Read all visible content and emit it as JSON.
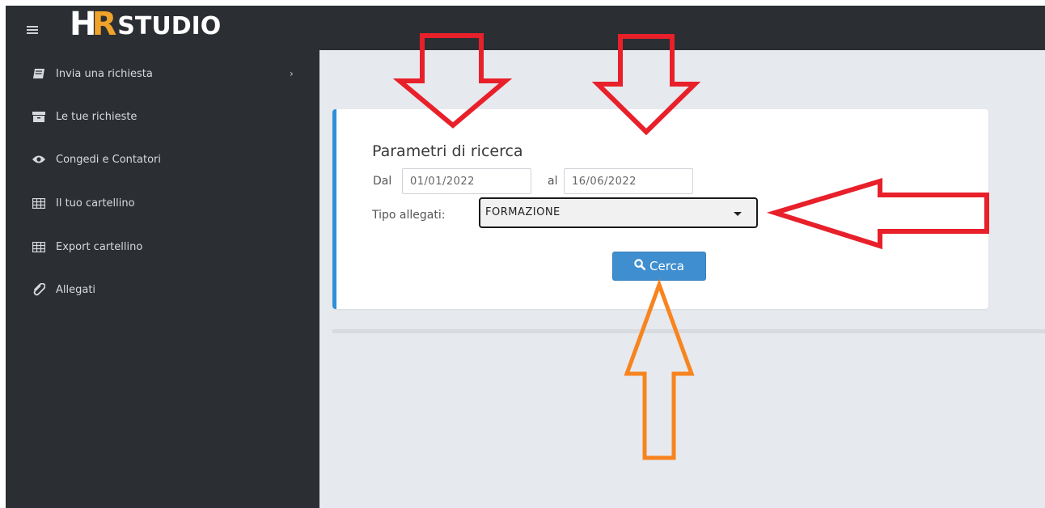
{
  "app": {
    "logo_h": "H",
    "logo_r": "R",
    "logo_studio": "STUDIO"
  },
  "sidebar": {
    "items": [
      {
        "label": "Invia una richiesta",
        "icon": "book-icon",
        "has_submenu": true,
        "chevron": "›"
      },
      {
        "label": "Le tue richieste",
        "icon": "archive-icon"
      },
      {
        "label": "Congedi e Contatori",
        "icon": "eye-icon"
      },
      {
        "label": "Il tuo cartellino",
        "icon": "table-icon"
      },
      {
        "label": "Export cartellino",
        "icon": "table-icon"
      },
      {
        "label": "Allegati",
        "icon": "paperclip-icon"
      }
    ]
  },
  "search_panel": {
    "title": "Parametri di ricerca",
    "from_label": "Dal",
    "from_value": "01/01/2022",
    "to_label": "al",
    "to_value": "16/06/2022",
    "type_label": "Tipo allegati:",
    "type_selected": "FORMAZIONE",
    "search_button_label": "Cerca"
  },
  "colors": {
    "sidebar_bg": "#2b2e33",
    "content_bg": "#e6e9ed",
    "panel_accent": "#2f8fd8",
    "button_bg": "#3f8fd0",
    "logo_accent": "#f0a32a",
    "annotation_red": "#e8202a",
    "annotation_orange": "#f7841e"
  }
}
